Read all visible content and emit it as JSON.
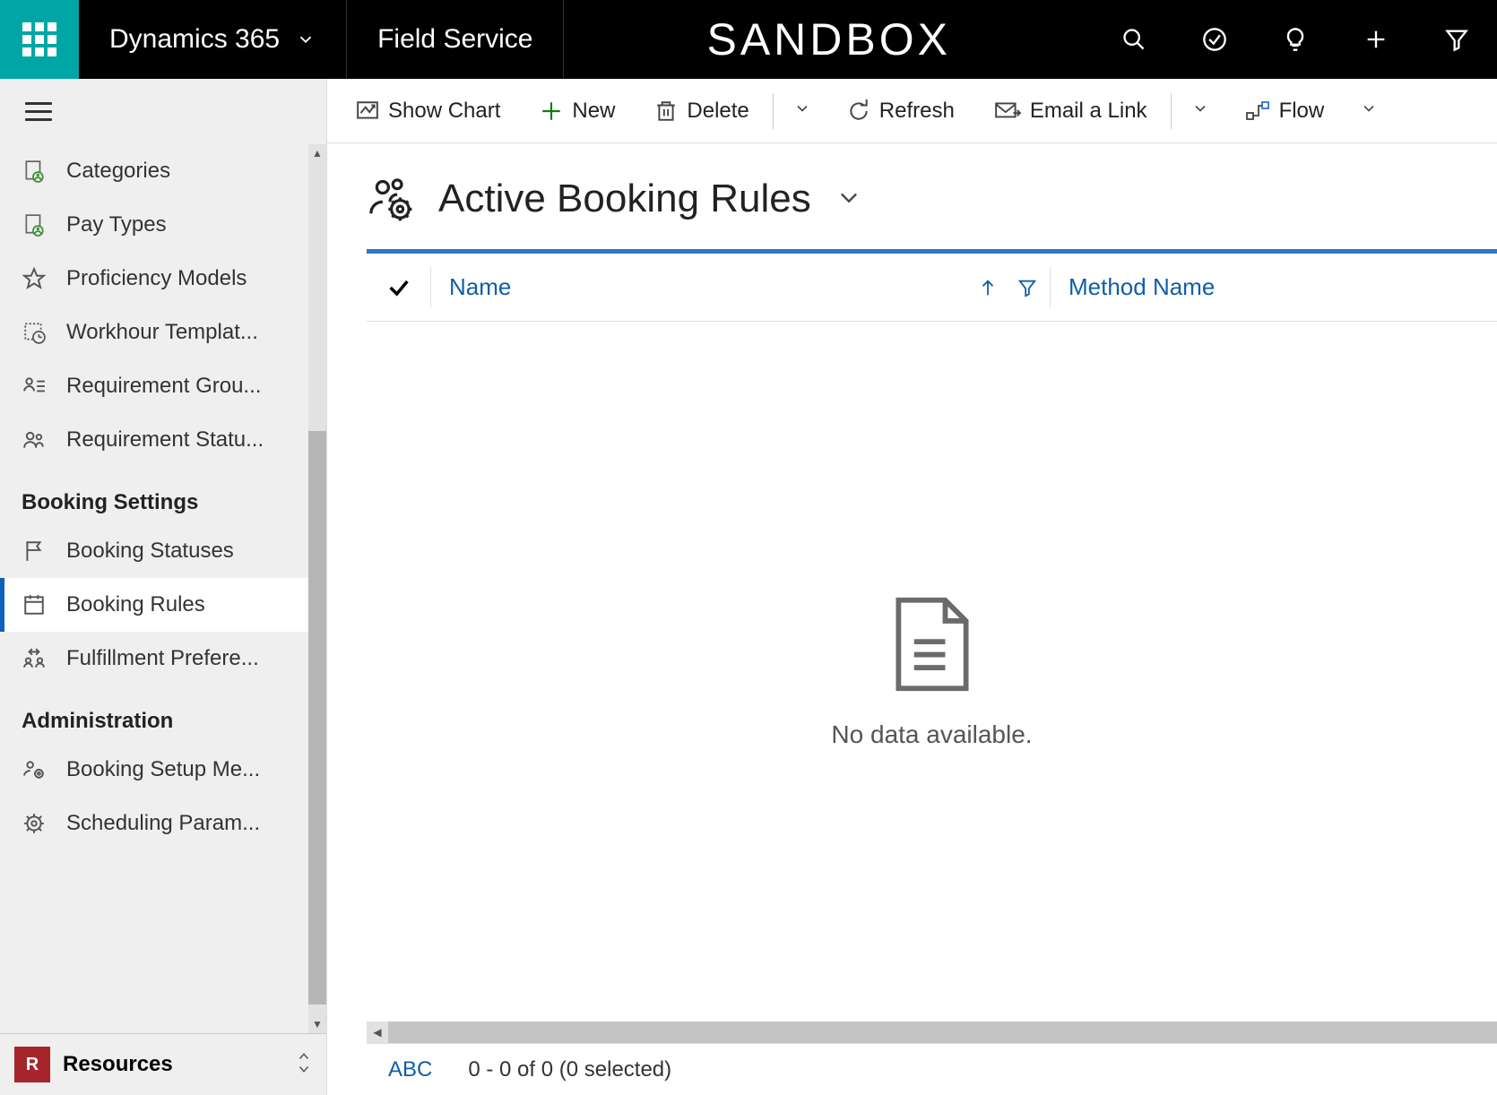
{
  "topbar": {
    "app_name": "Dynamics 365",
    "module": "Field Service",
    "env": "SANDBOX"
  },
  "commands": {
    "show_chart": "Show Chart",
    "new": "New",
    "delete": "Delete",
    "refresh": "Refresh",
    "email_link": "Email a Link",
    "flow": "Flow"
  },
  "view": {
    "title": "Active Booking Rules",
    "columns": {
      "name": "Name",
      "method_name": "Method Name"
    },
    "empty": "No data available."
  },
  "sidebar": {
    "items_top": [
      {
        "label": "Categories"
      },
      {
        "label": "Pay Types"
      },
      {
        "label": "Proficiency Models"
      },
      {
        "label": "Workhour Templat..."
      },
      {
        "label": "Requirement Grou..."
      },
      {
        "label": "Requirement Statu..."
      }
    ],
    "group_booking": "Booking Settings",
    "items_booking": [
      {
        "label": "Booking Statuses"
      },
      {
        "label": "Booking Rules"
      },
      {
        "label": "Fulfillment Prefere..."
      }
    ],
    "group_admin": "Administration",
    "items_admin": [
      {
        "label": "Booking Setup Me..."
      },
      {
        "label": "Scheduling Param..."
      }
    ],
    "area_badge": "R",
    "area_label": "Resources"
  },
  "footer": {
    "abc": "ABC",
    "paging": "0 - 0 of 0 (0 selected)"
  }
}
